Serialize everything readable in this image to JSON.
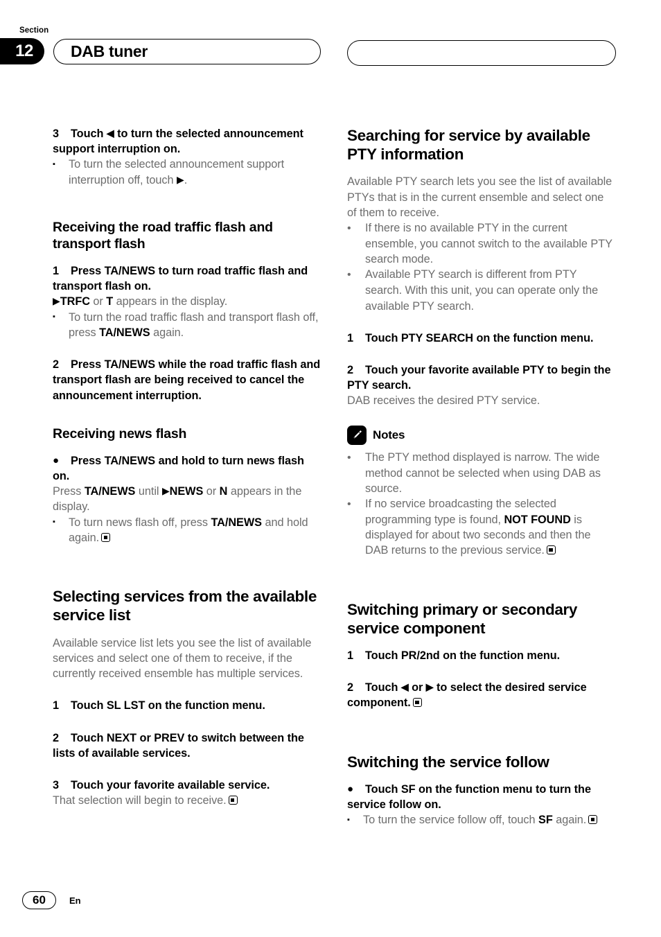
{
  "header": {
    "section_label": "Section",
    "section_number": "12",
    "title": "DAB tuner"
  },
  "footer": {
    "page_number": "60",
    "language": "En"
  },
  "left_column": {
    "step3_announce": {
      "num": "3",
      "text_before": "Touch",
      "arrow": "◀",
      "text_after": "to turn the selected announcement support interruption on."
    },
    "note_announce_off": {
      "bullet": "▪",
      "text_before": "To turn the selected announcement support interruption off, touch",
      "arrow": "▶",
      "text_after": "."
    },
    "heading_road_traffic": "Receiving the road traffic flash and transport flash",
    "step1_ta_news": {
      "num": "1",
      "text": "Press TA/NEWS to turn road traffic flash and transport flash on."
    },
    "trfc_line": {
      "arrow": "▶",
      "bold1": "TRFC",
      "mid": " or ",
      "bold2": "T",
      "tail": " appears in the display."
    },
    "note_trfc_off": {
      "bullet": "▪",
      "text_before": "To turn the road traffic flash and transport flash off, press",
      "bold": "TA/NEWS",
      "text_after": "again."
    },
    "step2_ta_news": {
      "num": "2",
      "text": "Press TA/NEWS while the road traffic flash and transport flash are being received to cancel the announcement interruption."
    },
    "heading_news_flash": "Receiving news flash",
    "bullet_news_flash": {
      "marker": "●",
      "text": "Press TA/NEWS and hold to turn news flash on."
    },
    "press_until_line": {
      "pre": "Press ",
      "bold1": "TA/NEWS",
      "mid": " until ",
      "arrow": "▶",
      "bold2": "NEWS",
      "mid2": " or ",
      "bold3": "N",
      "tail": " appears in the display."
    },
    "note_news_off": {
      "bullet": "▪",
      "text_before": "To turn news flash off, press",
      "bold": "TA/NEWS",
      "text_after": "and hold again."
    },
    "heading_selecting_services": "Selecting services from the available service list",
    "selecting_intro": "Available service list lets you see the list of available services and select one of them to receive, if the currently received ensemble has multiple services.",
    "step1_sl_lst": {
      "num": "1",
      "text": "Touch SL LST on the function menu."
    },
    "step2_next_prev": {
      "num": "2",
      "text": "Touch NEXT or PREV to switch between the lists of available services."
    },
    "step3_favorite_service": {
      "num": "3",
      "text": "Touch your favorite available service."
    },
    "selection_begin": "That selection will begin to receive."
  },
  "right_column": {
    "heading_searching_pty": "Searching for service by available PTY information",
    "pty_intro": "Available PTY search lets you see the list of available PTYs that is in the current ensemble and select one of them to receive.",
    "pty_bullets": [
      "If there is no available PTY in the current ensemble, you cannot switch to the available PTY search mode.",
      "Available PTY search is different from PTY search. With this unit, you can operate only the available PTY search."
    ],
    "bullet_char": "•",
    "step1_pty_search": {
      "num": "1",
      "text": "Touch PTY SEARCH on the function menu."
    },
    "step2_favorite_pty": {
      "num": "2",
      "text": "Touch your favorite available PTY to begin the PTY search."
    },
    "dab_receives": "DAB receives the desired PTY service.",
    "notes": {
      "title": "Notes",
      "icon": "pencil-icon",
      "items": [
        {
          "text_before": "The PTY method displayed is narrow. The wide method cannot be selected when using DAB as source.",
          "bold": "",
          "text_after": ""
        },
        {
          "text_before": "If no service broadcasting the selected programming type is found,",
          "bold": "NOT FOUND",
          "text_after": "is displayed for about two seconds and then the DAB returns to the previous service."
        }
      ]
    },
    "heading_switching_primary": "Switching primary or secondary service component",
    "step1_pr2nd": {
      "num": "1",
      "text": "Touch PR/2nd on the function menu."
    },
    "step2_select_component": {
      "num": "2",
      "text_before": "Touch",
      "arrow_left": "◀",
      "mid": "or",
      "arrow_right": "▶",
      "text_after": "to select the desired service component."
    },
    "heading_switching_service_follow": "Switching the service follow",
    "bullet_service_follow": {
      "marker": "●",
      "text": "Touch SF on the function menu to turn the service follow on."
    },
    "note_service_follow_off": {
      "bullet": "▪",
      "text_before": "To turn the service follow off, touch",
      "bold": "SF",
      "text_after": "again."
    }
  }
}
